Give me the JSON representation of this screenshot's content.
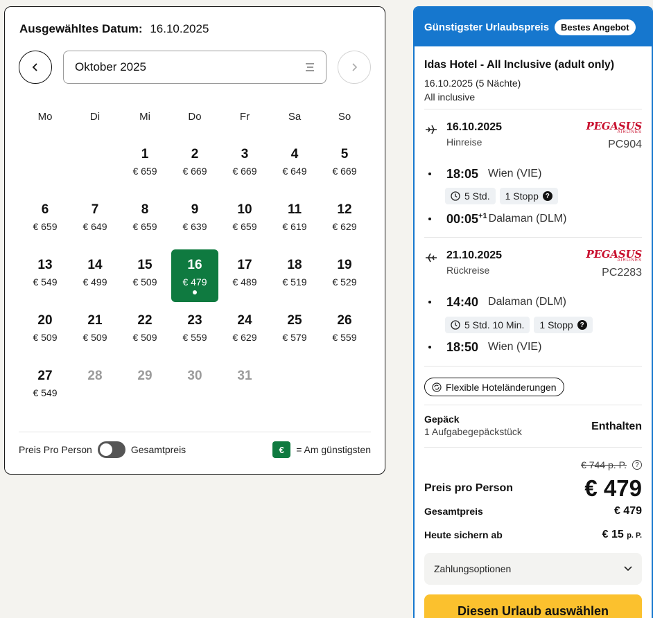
{
  "calendar": {
    "selected_label": "Ausgewähltes Datum:",
    "selected_value": "16.10.2025",
    "month_label": "Oktober 2025",
    "weekdays": [
      "Mo",
      "Di",
      "Mi",
      "Do",
      "Fr",
      "Sa",
      "So"
    ],
    "leading_blanks": 2,
    "days": [
      {
        "d": "1",
        "p": "€ 659"
      },
      {
        "d": "2",
        "p": "€ 669"
      },
      {
        "d": "3",
        "p": "€ 669"
      },
      {
        "d": "4",
        "p": "€ 649"
      },
      {
        "d": "5",
        "p": "€ 669"
      },
      {
        "d": "6",
        "p": "€ 659"
      },
      {
        "d": "7",
        "p": "€ 649"
      },
      {
        "d": "8",
        "p": "€ 659"
      },
      {
        "d": "9",
        "p": "€ 639"
      },
      {
        "d": "10",
        "p": "€ 659"
      },
      {
        "d": "11",
        "p": "€ 619"
      },
      {
        "d": "12",
        "p": "€ 629"
      },
      {
        "d": "13",
        "p": "€ 549"
      },
      {
        "d": "14",
        "p": "€ 499"
      },
      {
        "d": "15",
        "p": "€ 509"
      },
      {
        "d": "16",
        "p": "€ 479",
        "selected": true
      },
      {
        "d": "17",
        "p": "€ 489"
      },
      {
        "d": "18",
        "p": "€ 519"
      },
      {
        "d": "19",
        "p": "€ 529"
      },
      {
        "d": "20",
        "p": "€ 509"
      },
      {
        "d": "21",
        "p": "€ 509"
      },
      {
        "d": "22",
        "p": "€ 509"
      },
      {
        "d": "23",
        "p": "€ 559"
      },
      {
        "d": "24",
        "p": "€ 629"
      },
      {
        "d": "25",
        "p": "€ 579"
      },
      {
        "d": "26",
        "p": "€ 559"
      },
      {
        "d": "27",
        "p": "€ 549"
      },
      {
        "d": "28",
        "p": "",
        "muted": true
      },
      {
        "d": "29",
        "p": "",
        "muted": true
      },
      {
        "d": "30",
        "p": "",
        "muted": true
      },
      {
        "d": "31",
        "p": "",
        "muted": true
      }
    ],
    "toggle_left": "Preis Pro Person",
    "toggle_right": "Gesamtpreis",
    "legend_badge": "€",
    "legend_text": "= Am günstigsten",
    "accent_color": "#0f7a40"
  },
  "offer": {
    "header_title": "Günstigster Urlaubspreis",
    "header_badge": "Bestes Angebot",
    "header_color": "#1677ce",
    "hotel_name": "Idas Hotel - All Inclusive (adult only)",
    "hotel_dates": "16.10.2025 (5 Nächte)",
    "hotel_board": "All inclusive",
    "outbound": {
      "date": "16.10.2025",
      "kind": "Hinreise",
      "airline": "PEGASUS",
      "airline_sub": "AIRLINES",
      "flight_no": "PC904",
      "dep_time": "18:05",
      "dep_place": "Wien (VIE)",
      "duration": "5 Std.",
      "stops": "1 Stopp",
      "arr_time": "00:05",
      "arr_offset": "+1",
      "arr_place": "Dalaman (DLM)"
    },
    "inbound": {
      "date": "21.10.2025",
      "kind": "Rückreise",
      "airline": "PEGASUS",
      "airline_sub": "AIRLINES",
      "flight_no": "PC2283",
      "dep_time": "14:40",
      "dep_place": "Dalaman (DLM)",
      "duration": "5 Std. 10 Min.",
      "stops": "1 Stopp",
      "arr_time": "18:50",
      "arr_place": "Wien (VIE)"
    },
    "flex_label": "Flexible Hoteländerungen",
    "luggage_label": "Gepäck",
    "luggage_sub": "1 Aufgabegepäckstück",
    "luggage_value": "Enthalten",
    "old_price": "€ 744 p. P.",
    "pp_label": "Preis pro Person",
    "pp_value": "€ 479",
    "total_label": "Gesamtpreis",
    "total_value": "€ 479",
    "deposit_label": "Heute sichern ab",
    "deposit_value": "€ 15",
    "deposit_unit": "p. P.",
    "payment_label": "Zahlungsoptionen",
    "cta_label": "Diesen Urlaub auswählen",
    "cta_color": "#fbc12e"
  }
}
